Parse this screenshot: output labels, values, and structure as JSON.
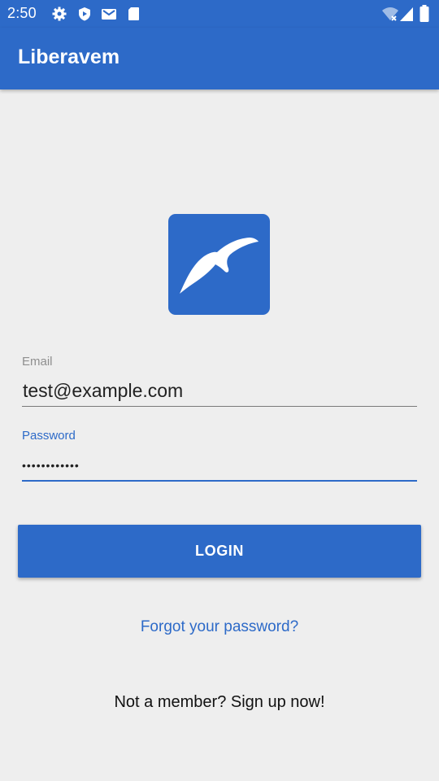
{
  "status_bar": {
    "time": "2:50",
    "icons": [
      "gear-icon",
      "shield-icon",
      "gmail-icon",
      "sd-card-icon",
      "wifi-off-icon",
      "signal-icon",
      "battery-icon"
    ]
  },
  "app_bar": {
    "title": "Liberavem"
  },
  "logo": {
    "icon": "bird-logo-icon",
    "background": "#2d6ac8"
  },
  "form": {
    "email_label": "Email",
    "email_value": "test@example.com",
    "password_label": "Password",
    "password_masked": "••••••••••••",
    "login_label": "LOGIN"
  },
  "links": {
    "forgot_password": "Forgot your password?",
    "signup": "Not a member? Sign up now!"
  },
  "colors": {
    "primary": "#2d6ac8",
    "background": "#eeeeee"
  }
}
